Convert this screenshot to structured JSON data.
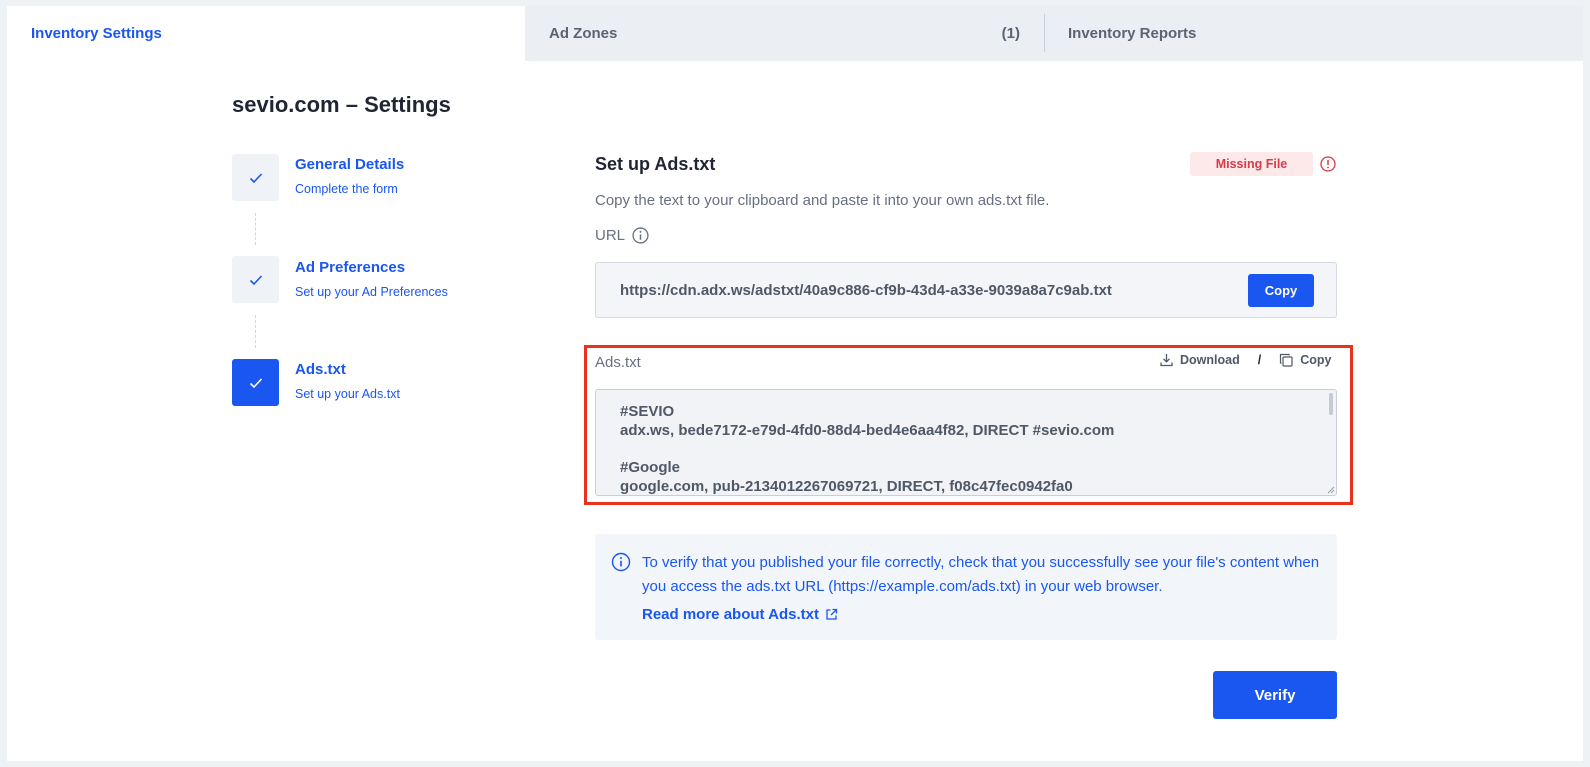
{
  "tabs": {
    "inventory_settings": "Inventory Settings",
    "ad_zones": "Ad Zones",
    "ad_zones_count": "(1)",
    "inventory_reports": "Inventory Reports"
  },
  "page_title": "sevio.com – Settings",
  "steps": [
    {
      "title": "General Details",
      "subtitle": "Complete the form",
      "state": "done"
    },
    {
      "title": "Ad Preferences",
      "subtitle": "Set up your Ad Preferences",
      "state": "done"
    },
    {
      "title": "Ads.txt",
      "subtitle": "Set up your Ads.txt",
      "state": "active"
    }
  ],
  "setup": {
    "title": "Set up Ads.txt",
    "status_badge": "Missing File",
    "instructions": "Copy the text to your clipboard and paste it into your own ads.txt file.",
    "url_label": "URL",
    "url_value": "https://cdn.adx.ws/adstxt/40a9c886-cf9b-43d4-a33e-9039a8a7c9ab.txt",
    "copy_label": "Copy"
  },
  "ads_txt": {
    "label": "Ads.txt",
    "download_label": "Download",
    "separator": "/",
    "copy_label": "Copy",
    "lines": [
      "#SEVIO",
      "adx.ws, bede7172-e79d-4fd0-88d4-bed4e6aa4f82, DIRECT #sevio.com",
      "#Google",
      "google.com, pub-2134012267069721, DIRECT, f08c47fec0942fa0"
    ]
  },
  "info": {
    "text": "To verify that you published your file correctly, check that you successfully see your file's content when you access the ads.txt URL (https://example.com/ads.txt) in your web browser.",
    "link_label": "Read more about Ads.txt"
  },
  "verify_label": "Verify",
  "colors": {
    "accent": "#1a56f0",
    "badge_bg": "#fde8ea",
    "badge_text": "#d93a4a",
    "highlight": "#e8321e"
  }
}
